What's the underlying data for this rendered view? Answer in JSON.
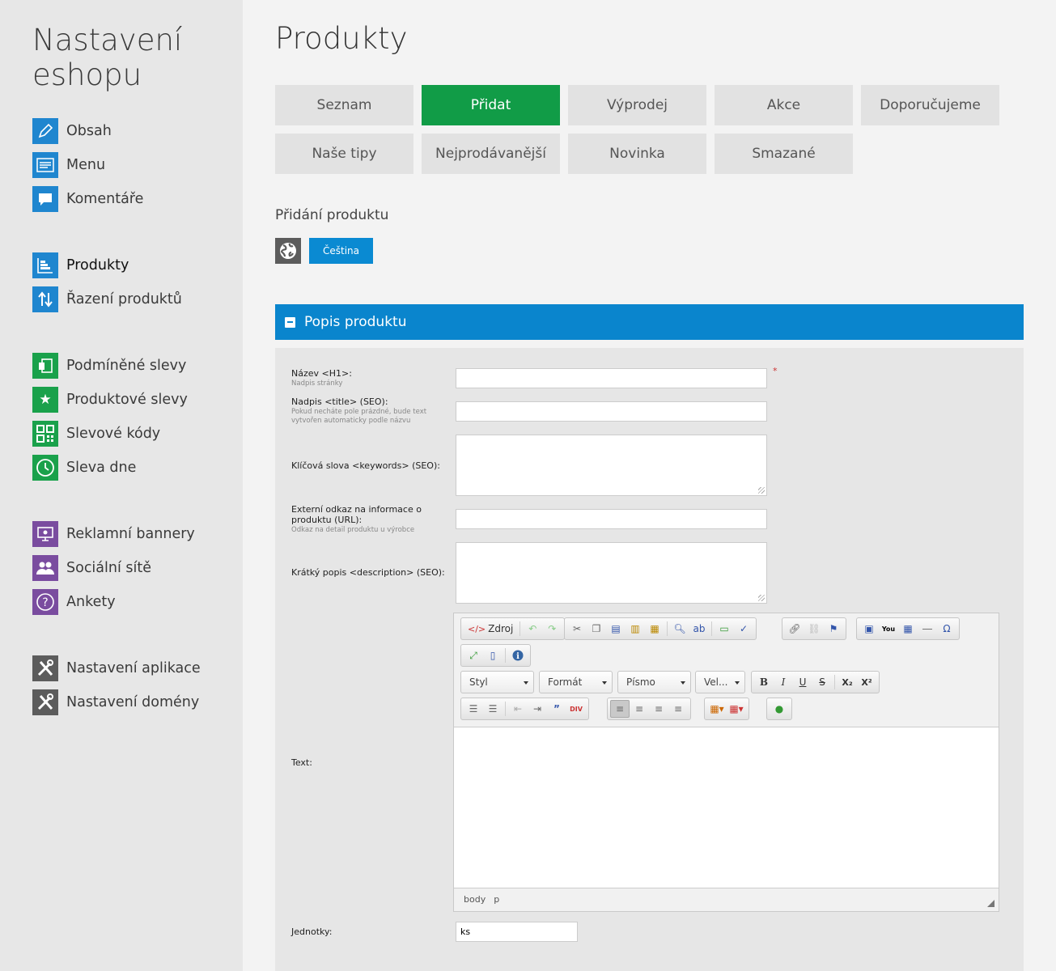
{
  "sidebar": {
    "title": "Nastavení eshopu",
    "items": [
      {
        "label": "Obsah"
      },
      {
        "label": "Menu"
      },
      {
        "label": "Komentáře"
      },
      {
        "label": "Produkty"
      },
      {
        "label": "Řazení produktů"
      },
      {
        "label": "Podmíněné slevy"
      },
      {
        "label": "Produktové slevy"
      },
      {
        "label": "Slevové kódy"
      },
      {
        "label": "Sleva dne"
      },
      {
        "label": "Reklamní bannery"
      },
      {
        "label": "Sociální sítě"
      },
      {
        "label": "Ankety"
      },
      {
        "label": "Nastavení aplikace"
      },
      {
        "label": "Nastavení domény"
      }
    ],
    "active": "Produkty"
  },
  "main": {
    "title": "Produkty",
    "tabs": [
      {
        "label": "Seznam"
      },
      {
        "label": "Přidat"
      },
      {
        "label": "Výprodej"
      },
      {
        "label": "Akce"
      },
      {
        "label": "Doporučujeme"
      },
      {
        "label": "Naše tipy"
      },
      {
        "label": "Nejprodávanější"
      },
      {
        "label": "Novinka"
      },
      {
        "label": "Smazané"
      }
    ],
    "active_tab": "Přidat",
    "subtitle": "Přidání produktu",
    "language_button": "Čeština"
  },
  "panel": {
    "title": "Popis produktu",
    "fields": {
      "name": {
        "label": "Název <H1>:",
        "hint": "Nadpis stránky",
        "value": "",
        "required_mark": "*"
      },
      "title": {
        "label": "Nadpis <title> (SEO):",
        "hint": "Pokud necháte pole prázdné, bude text vytvořen automaticky podle názvu",
        "value": ""
      },
      "keywords": {
        "label": "Klíčová slova <keywords> (SEO):",
        "value": ""
      },
      "external": {
        "label": "Externí odkaz na informace o produktu (URL):",
        "hint": "Odkaz na detail produktu u výrobce",
        "value": ""
      },
      "description": {
        "label": "Krátký popis <description> (SEO):",
        "value": ""
      },
      "text": {
        "label": "Text:"
      },
      "units": {
        "label": "Jednotky:",
        "value": "ks"
      }
    }
  },
  "editor": {
    "source_label": "Zdroj",
    "styles_combo": "Styl",
    "format_combo": "Formát",
    "font_combo": "Písmo",
    "size_combo": "Vel...",
    "path": [
      "body",
      "p"
    ]
  },
  "colors": {
    "accent_blue": "#0a85cd",
    "active_green": "#119c47",
    "sidebar_bg": "#e7e7e7"
  }
}
